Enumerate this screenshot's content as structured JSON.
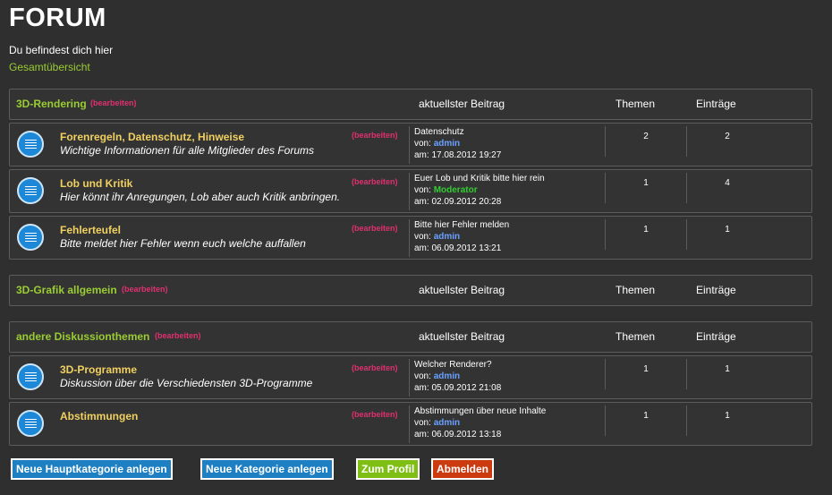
{
  "page": {
    "title": "FORUM",
    "location_label": "Du befindest dich hier",
    "breadcrumb": "Gesamtübersicht"
  },
  "labels": {
    "edit": "(bearbeiten)",
    "latest_header": "aktuellster Beitrag",
    "topics_header": "Themen",
    "entries_header": "Einträge",
    "by": "von:",
    "at": "am:"
  },
  "categories": [
    {
      "name": "3D-Rendering",
      "forums": [
        {
          "name": "Forenregeln, Datenschutz, Hinweise",
          "desc": "Wichtige Informationen für alle Mitglieder des Forums",
          "latest_title": "Datenschutz",
          "latest_user": "admin",
          "latest_date": "17.08.2012 19:27",
          "topics": "2",
          "entries": "2"
        },
        {
          "name": "Lob und Kritik",
          "desc": "Hier könnt ihr Anregungen, Lob aber auch Kritik anbringen.",
          "latest_title": "Euer Lob und Kritik bitte hier rein",
          "latest_user": "Moderator",
          "latest_date": "02.09.2012 20:28",
          "topics": "1",
          "entries": "4"
        },
        {
          "name": "Fehlerteufel",
          "desc": "Bitte meldet hier Fehler wenn euch welche auffallen",
          "latest_title": "Bitte hier Fehler melden",
          "latest_user": "admin",
          "latest_date": "06.09.2012 13:21",
          "topics": "1",
          "entries": "1"
        }
      ]
    },
    {
      "name": "3D-Grafik allgemein",
      "forums": []
    },
    {
      "name": "andere Diskussionthemen",
      "forums": [
        {
          "name": "3D-Programme",
          "desc": "Diskussion über die Verschiedensten 3D-Programme",
          "latest_title": "Welcher Renderer?",
          "latest_user": "admin",
          "latest_date": "05.09.2012 21:08",
          "topics": "1",
          "entries": "1"
        },
        {
          "name": "Abstimmungen",
          "desc": "",
          "latest_title": "Abstimmungen über neue Inhalte",
          "latest_user": "admin",
          "latest_date": "06.09.2012 13:18",
          "topics": "1",
          "entries": "1"
        }
      ]
    }
  ],
  "buttons": {
    "new_main_category": "Neue Hauptkategorie anlegen",
    "new_category": "Neue Kategorie anlegen",
    "profile": "Zum Profil",
    "logout": "Abmelden"
  },
  "colors": {
    "background": "#2f2f2f",
    "category_name": "#9acd32",
    "forum_name": "#f0d060",
    "edit_link": "#e0306f",
    "admin_user": "#6aa0ff",
    "moderator_user": "#33cc33",
    "button_blue": "#1e7fc2",
    "button_green": "#7fbf14",
    "button_red": "#cc3a10"
  },
  "icons": {
    "forum_icon": "document-lines-icon"
  }
}
